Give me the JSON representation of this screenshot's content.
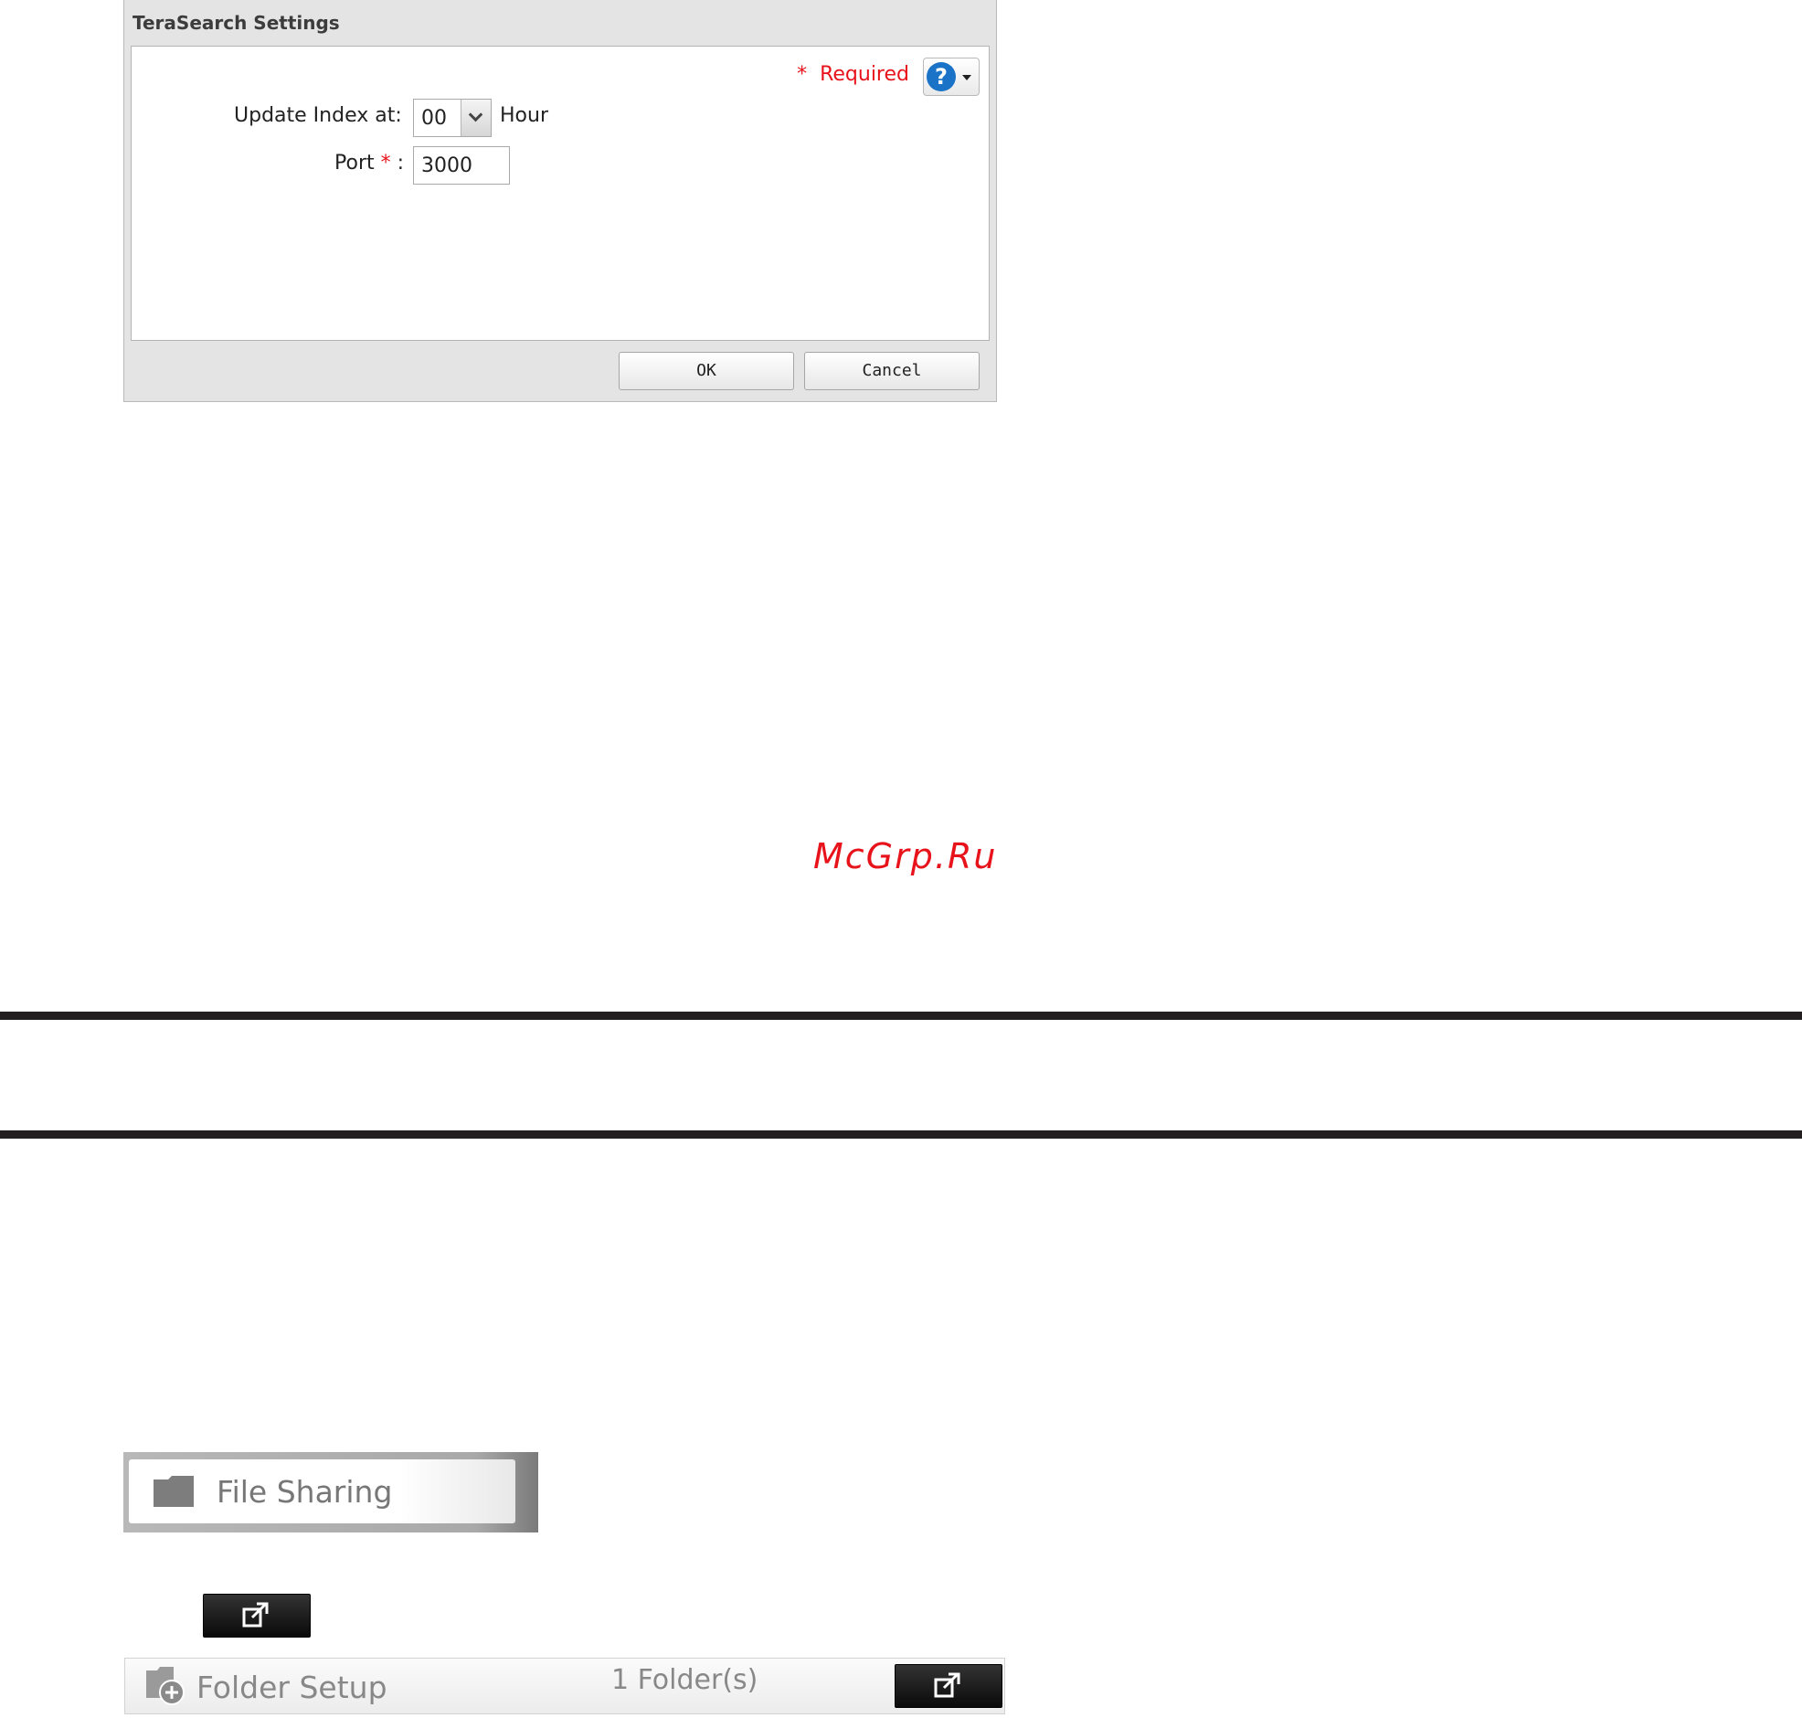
{
  "dialog": {
    "title": "TeraSearch Settings",
    "required_star": "*",
    "required_label": "Required",
    "help_icon": "question-icon",
    "update_index_label": "Update Index at:",
    "update_index_value": "00",
    "hour_label": "Hour",
    "port_label": "Port",
    "port_star": "*",
    "port_colon": ":",
    "port_value": "3000",
    "ok_label": "OK",
    "cancel_label": "Cancel"
  },
  "watermark": "McGrp.Ru",
  "file_sharing": {
    "label": "File Sharing",
    "icon": "folder-icon"
  },
  "open_button": {
    "icon": "open-external-icon"
  },
  "folder_setup": {
    "label": "Folder Setup",
    "count": "1 Folder(s)",
    "icon": "folder-add-icon"
  },
  "colors": {
    "required_red": "#e8131a",
    "help_blue": "#1a73c6",
    "rule": "#231f20"
  }
}
